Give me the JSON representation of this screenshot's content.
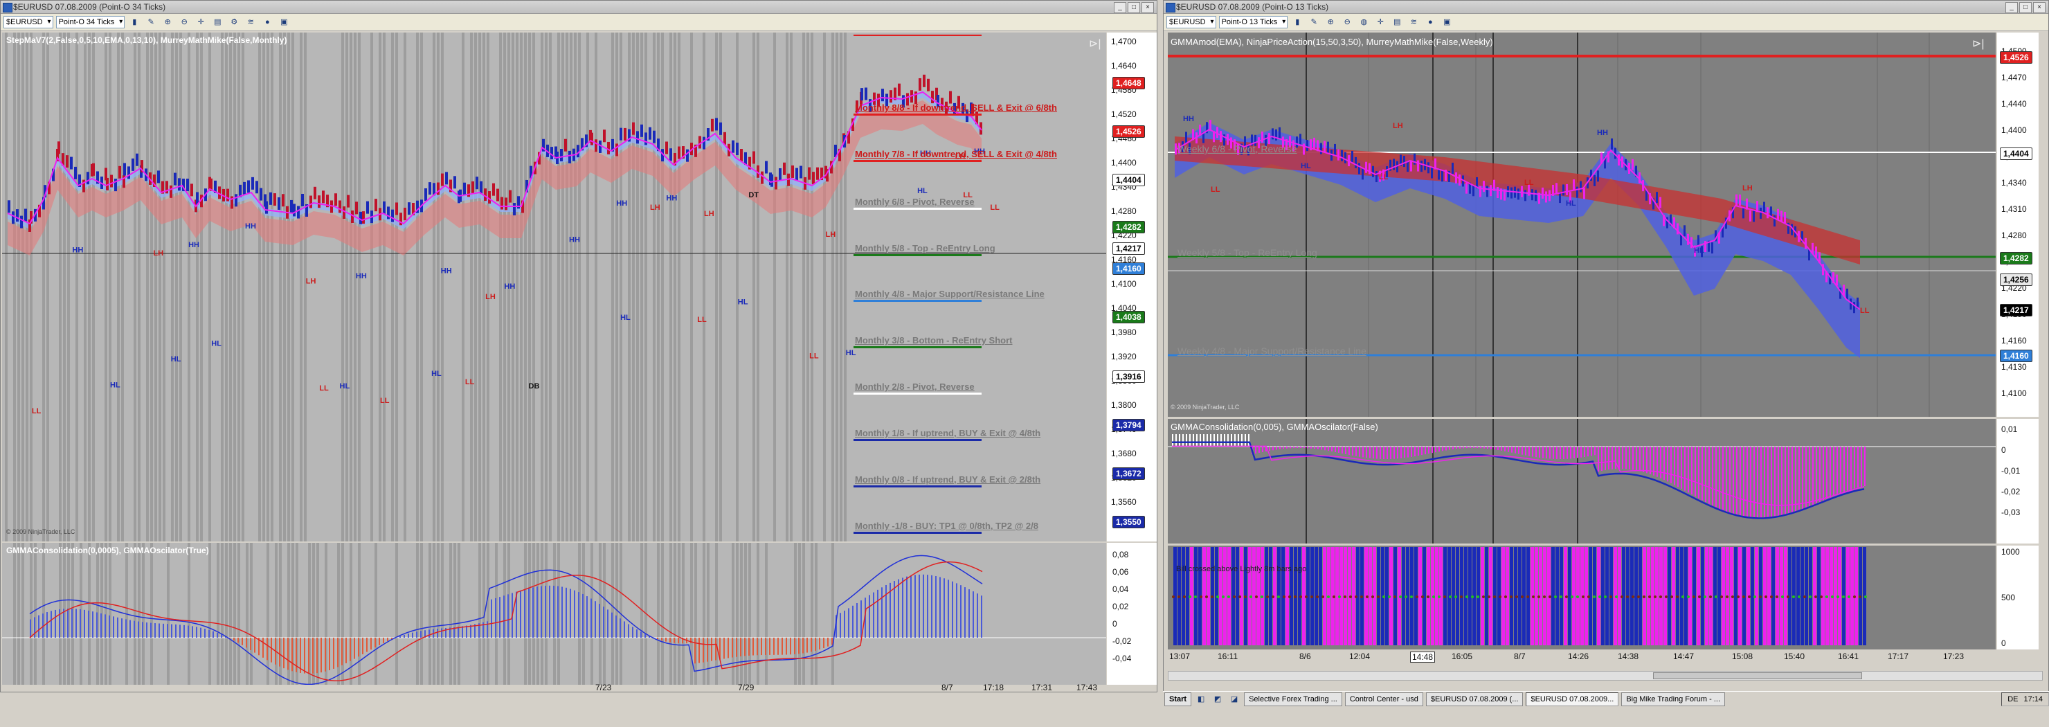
{
  "left_window": {
    "title": "$EURUSD  07.08.2009 (Point-O 34 Ticks)",
    "instrument": "$EURUSD",
    "interval": "Point-O 34 Ticks",
    "indicator_label": "StepMaV7(2,False,0,5,10,EMA,0,13,10),  MurreyMathMike(False,Monthly)",
    "copyright": "© 2009 NinjaTrader, LLC",
    "sub_label": "GMMAConsolidation(0,0005),  GMMAOscilator(True)",
    "price_ticks": [
      "1,4700",
      "1,4640",
      "1,4580",
      "1,4520",
      "1,4460",
      "1,4400",
      "1,4340",
      "1,4280",
      "1,4220",
      "1,4160",
      "1,4100",
      "1,4040",
      "1,3980",
      "1,3920",
      "1,3860",
      "1,3800",
      "1,3740",
      "1,3680",
      "1,3620",
      "1,3560"
    ],
    "osc_ticks": [
      "0,08",
      "0,06",
      "0,04",
      "0,02",
      "0",
      "-0,02",
      "-0,04"
    ],
    "x_labels": [
      "7/23",
      "7/29",
      "8/7",
      "17:18",
      "17:31",
      "17:43"
    ],
    "price_boxes": [
      {
        "text": "1,4648",
        "bg": "#e02020",
        "fg": "#ffffff"
      },
      {
        "text": "1,4526",
        "bg": "#e02020",
        "fg": "#ffffff"
      },
      {
        "text": "1,4404",
        "bg": "#ffffff",
        "fg": "#000000"
      },
      {
        "text": "1,4282",
        "bg": "#1a7a1a",
        "fg": "#ffffff"
      },
      {
        "text": "1,4217",
        "bg": "#ffffff",
        "fg": "#000000"
      },
      {
        "text": "1,4160",
        "bg": "#2f7fd8",
        "fg": "#ffffff"
      },
      {
        "text": "1,4038",
        "bg": "#1a7a1a",
        "fg": "#ffffff"
      },
      {
        "text": "1,3916",
        "bg": "#ffffff",
        "fg": "#000000"
      },
      {
        "text": "1,3794",
        "bg": "#1a2aa8",
        "fg": "#ffffff"
      },
      {
        "text": "1,3672",
        "bg": "#1a2aa8",
        "fg": "#ffffff"
      },
      {
        "text": "1,3550",
        "bg": "#1a2aa8",
        "fg": "#ffffff"
      }
    ],
    "murrey_labels": [
      {
        "text": "Monthly 8/8 - If downtrend, SELL & Exit @ 6/8th",
        "color": "#cc1a1a",
        "line": "#e02020"
      },
      {
        "text": "Monthly 7/8 - If downtrend, SELL & Exit @ 4/8th",
        "color": "#cc1a1a",
        "line": "#e02020"
      },
      {
        "text": "Monthly 6/8 - Pivot, Reverse",
        "color": "#7a7a7a",
        "line": "#ffffff"
      },
      {
        "text": "Monthly 5/8 - Top - ReEntry Long",
        "color": "#7a7a7a",
        "line": "#1a7a1a"
      },
      {
        "text": "Monthly 4/8 - Major Support/Resistance Line",
        "color": "#7a7a7a",
        "line": "#2f7fd8"
      },
      {
        "text": "Monthly 3/8 - Bottom - ReEntry Short",
        "color": "#7a7a7a",
        "line": "#1a7a1a"
      },
      {
        "text": "Monthly 2/8 - Pivot, Reverse",
        "color": "#7a7a7a",
        "line": "#ffffff"
      },
      {
        "text": "Monthly 1/8 - If uptrend, BUY & Exit @ 4/8th",
        "color": "#7a7a7a",
        "line": "#1a2aa8"
      },
      {
        "text": "Monthly 0/8 - If uptrend, BUY & Exit @ 2/8th",
        "color": "#7a7a7a",
        "line": "#1a2aa8"
      },
      {
        "text": "Monthly -1/8 - BUY: TP1 @ 0/8th, TP2 @ 2/8",
        "color": "#7a7a7a",
        "line": "#1a2aa8"
      }
    ],
    "swing_labels": [
      "HH",
      "LH",
      "HL",
      "LL",
      "DT",
      "DB"
    ]
  },
  "right_window": {
    "title": "$EURUSD  07.08.2009 (Point-O 13 Ticks)",
    "instrument": "$EURUSD",
    "interval": "Point-O 13 Ticks",
    "indicator_label": "GMMAmod(EMA), NinjaPriceAction(15,50,3,50), MurreyMathMike(False,Weekly)",
    "copyright": "© 2009 NinjaTrader, LLC",
    "sub_label": "GMMAConsolidation(0,005), GMMAOscilator(False)",
    "sub2_text": "Bill crossed above Lightly 8m bars ago",
    "price_ticks": [
      "1,4500",
      "1,4470",
      "1,4440",
      "1,4400",
      "1,4370",
      "1,4340",
      "1,4310",
      "1,4280",
      "1,4250",
      "1,4220",
      "1,4190",
      "1,4160",
      "1,4130",
      "1,4100"
    ],
    "osc_ticks": [
      "0,01",
      "0",
      "-0,01",
      "-0,02",
      "-0,03"
    ],
    "cons_ticks": [
      "1000",
      "500",
      "0"
    ],
    "x_labels": [
      "13:07",
      "16:11",
      "8/6",
      "12:04",
      "14:48",
      "16:05",
      "8/7",
      "14:26",
      "14:38",
      "14:47",
      "15:08",
      "15:40",
      "16:41",
      "17:17",
      "17:23"
    ],
    "price_boxes": [
      {
        "text": "1,4526",
        "bg": "#e02020",
        "fg": "#ffffff"
      },
      {
        "text": "1,4404",
        "bg": "#ffffff",
        "fg": "#000000"
      },
      {
        "text": "1,4282",
        "bg": "#1a7a1a",
        "fg": "#ffffff"
      },
      {
        "text": "1,4256",
        "bg": "#e8e8e8",
        "fg": "#000000"
      },
      {
        "text": "1,4217",
        "bg": "#000000",
        "fg": "#ffffff"
      },
      {
        "text": "1,4160",
        "bg": "#2f7fd8",
        "fg": "#ffffff"
      }
    ],
    "weekly_labels": [
      {
        "text": "Weekly 6/8 - Pivot, Reverse",
        "color": "#8f8f8f"
      },
      {
        "text": "Weekly 5/8 - Top - ReEntry Long",
        "color": "#8f8f8f"
      },
      {
        "text": "Weekly 4/8 - Major Support/Resistance Line",
        "color": "#8f8f8f"
      }
    ]
  },
  "taskbar": {
    "start": "Start",
    "tasks": [
      "Selective Forex Trading ...",
      "Control Center - usd",
      "$EURUSD  07.08.2009 (...",
      "$EURUSD  07.08.2009...",
      "Big Mike Trading Forum - ..."
    ],
    "lang": "DE",
    "clock": "17:14"
  },
  "colors": {
    "up_bar": "#1a2ab8",
    "down_bar": "#c0122a",
    "cloud_red": "#e87878",
    "cloud_blue": "#5060e0",
    "magenta": "#ee22ee"
  }
}
